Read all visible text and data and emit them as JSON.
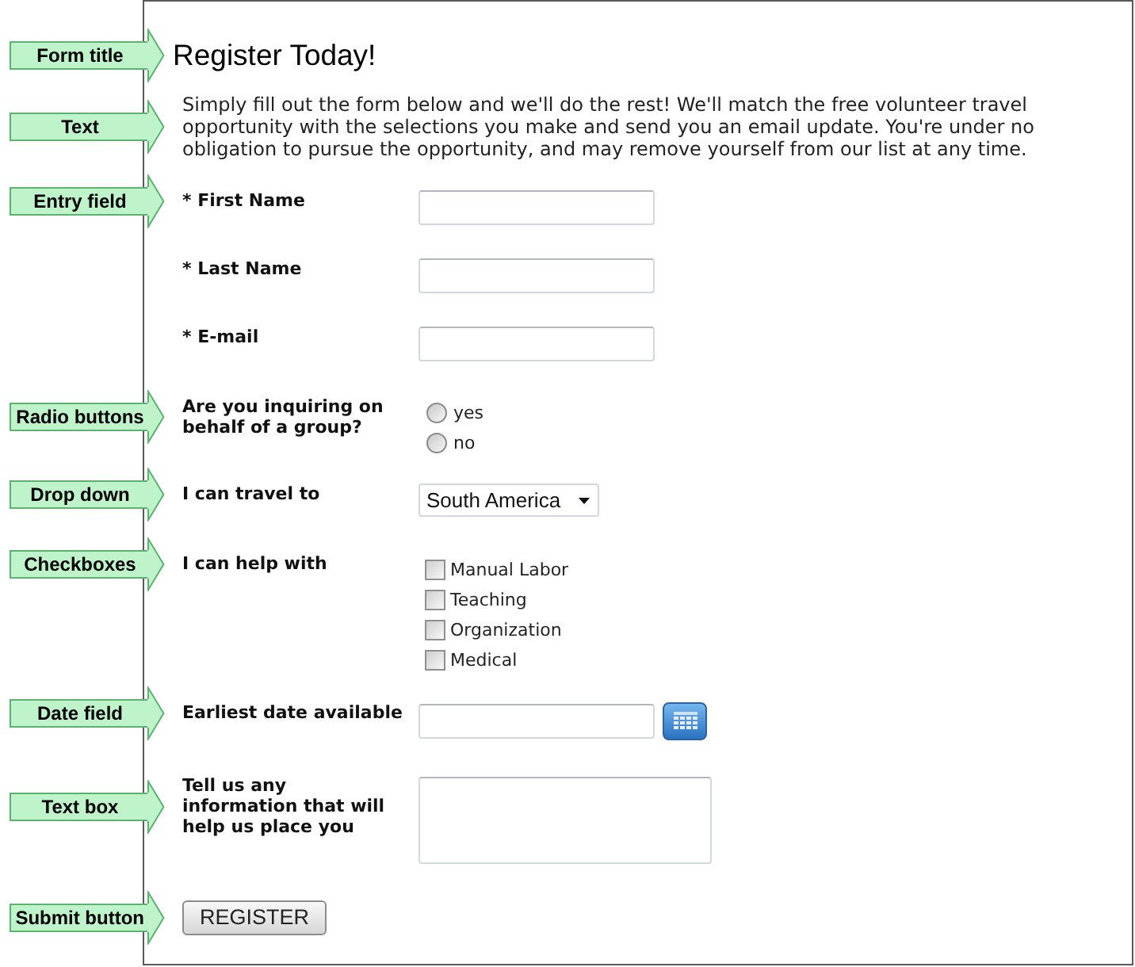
{
  "form": {
    "title": {
      "text": "Register Today!",
      "callout": "Form title"
    },
    "intro": {
      "text": "Simply fill out the form below and we'll do the rest! We'll match the free volunteer travel opportunity with the selections you make and send you an email update. You're under no obligation to pursue the opportunity, and may remove yourself from our list at any time.",
      "callout": "Text"
    },
    "fields": [
      {
        "kind": "text",
        "label": "* First Name",
        "callout": "Entry field"
      },
      {
        "kind": "text",
        "label": "* Last Name"
      },
      {
        "kind": "text",
        "label": "* E-mail"
      },
      {
        "kind": "radio",
        "label": "Are you inquiring on behalf of a group?",
        "callout": "Radio buttons",
        "options": [
          {
            "label": "yes",
            "selected": false
          },
          {
            "label": "no",
            "selected": false
          }
        ]
      },
      {
        "kind": "dropdown",
        "label": "I can travel to",
        "value": "South America",
        "callout": "Drop down"
      },
      {
        "kind": "checkboxes",
        "label": "I can help with",
        "callout": "Checkboxes",
        "options": [
          {
            "label": "Manual Labor",
            "checked": false
          },
          {
            "label": "Teaching",
            "checked": false
          },
          {
            "label": "Organization",
            "checked": false
          },
          {
            "label": "Medical",
            "checked": false
          }
        ]
      },
      {
        "kind": "date",
        "label": "Earliest date available",
        "callout": "Date field"
      },
      {
        "kind": "textarea",
        "label": "Tell us any information that will help us place you",
        "callout": "Text box"
      }
    ],
    "submit": {
      "label": "REGISTER",
      "callout": "Submit button"
    }
  }
}
